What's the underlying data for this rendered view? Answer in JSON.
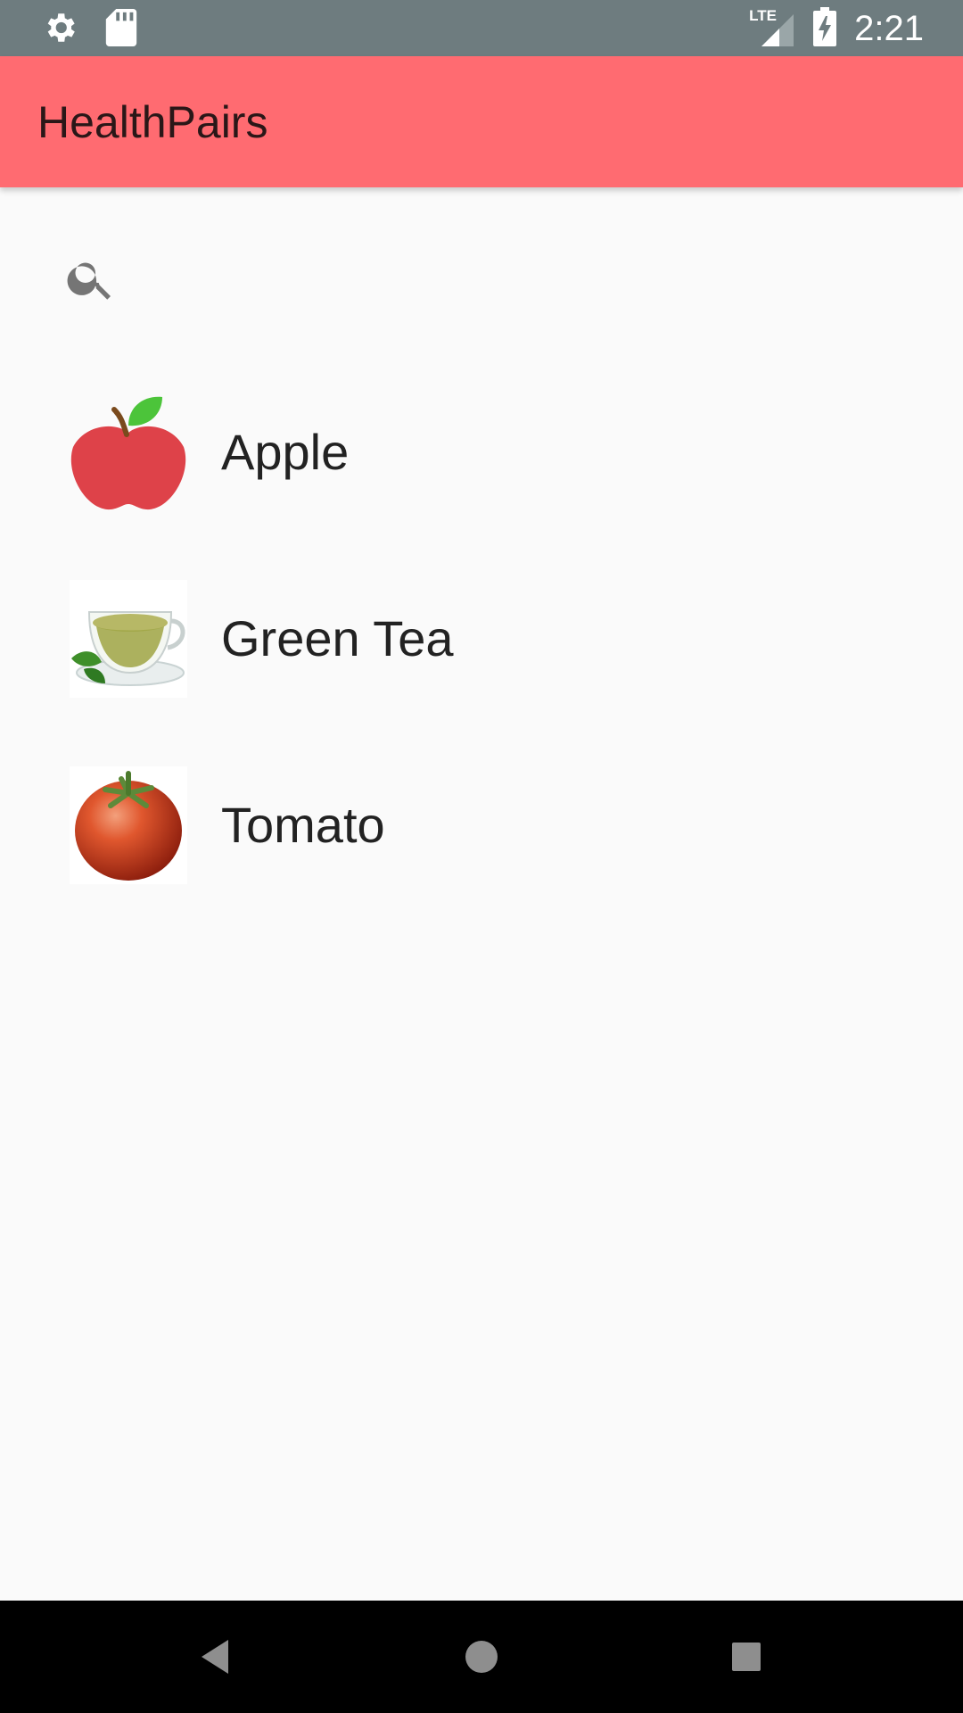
{
  "status_bar": {
    "time": "2:21",
    "network": "LTE",
    "icons": [
      "settings-icon",
      "sd-card-icon",
      "lte-signal-icon",
      "battery-charging-icon"
    ]
  },
  "app_bar": {
    "title": "HealthPairs",
    "color": "#FF6B71"
  },
  "search": {
    "icon": "search-icon"
  },
  "items": [
    {
      "label": "Apple",
      "image": "apple-image"
    },
    {
      "label": "Green Tea",
      "image": "green-tea-image"
    },
    {
      "label": "Tomato",
      "image": "tomato-image"
    }
  ],
  "nav_bar": {
    "buttons": [
      "back-icon",
      "home-icon",
      "recents-icon"
    ]
  }
}
